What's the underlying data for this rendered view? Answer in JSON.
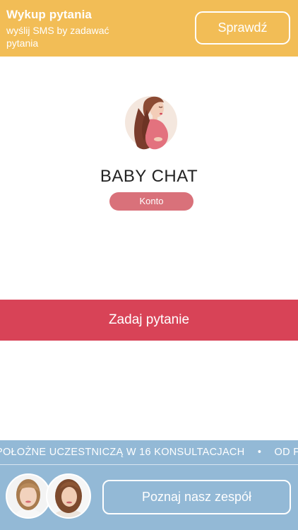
{
  "banner": {
    "title": "Wykup pytania",
    "subtitle": "wyślij SMS by zadawać pytania",
    "button_label": "Sprawdź",
    "color": "#f2bd56"
  },
  "app": {
    "logo_icon": "pregnant-woman-icon",
    "title": "BABY CHAT",
    "account_label": "Konto",
    "account_color": "#d9717a"
  },
  "ask": {
    "label": "Zadaj pytanie",
    "color": "#d84357"
  },
  "bottom": {
    "ticker_items": [
      "POŁOŻNE UCZESTNICZĄ W 16 KONSULTACJACH",
      "•",
      "OD PO"
    ],
    "team_button_label": "Poznaj nasz zespół",
    "color": "#93b9d6"
  }
}
